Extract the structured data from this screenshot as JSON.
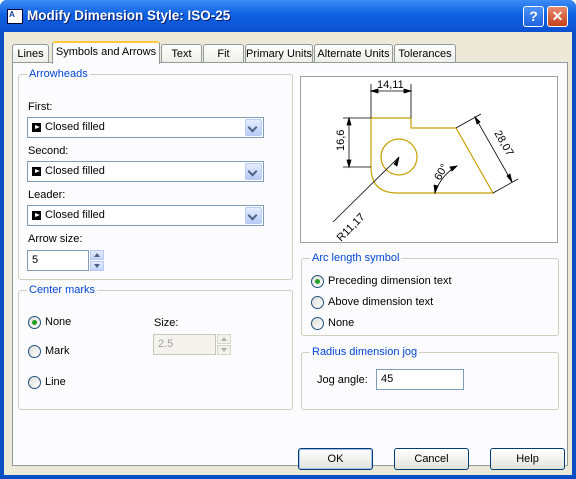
{
  "dialog": {
    "title": "Modify Dimension Style: ISO-25",
    "help_glyph": "?",
    "close_glyph": "✕",
    "app_icon_glyph": "A"
  },
  "tabs": [
    {
      "label": "Lines"
    },
    {
      "label": "Symbols and Arrows",
      "active": true
    },
    {
      "label": "Text"
    },
    {
      "label": "Fit"
    },
    {
      "label": "Primary Units"
    },
    {
      "label": "Alternate Units"
    },
    {
      "label": "Tolerances"
    }
  ],
  "arrowheads": {
    "title": "Arrowheads",
    "first_label": "First:",
    "first_value": "Closed filled",
    "second_label": "Second:",
    "second_value": "Closed filled",
    "leader_label": "Leader:",
    "leader_value": "Closed filled",
    "arrow_size_label": "Arrow size:",
    "arrow_size_value": "5"
  },
  "center_marks": {
    "title": "Center marks",
    "options": [
      "None",
      "Mark",
      "Line"
    ],
    "selected": "None",
    "size_label": "Size:",
    "size_value": "2.5"
  },
  "preview": {
    "dim_top": "14,11",
    "dim_left": "16,6",
    "dim_right": "28,07",
    "dim_angle": "60°",
    "dim_radius": "R11,17"
  },
  "arc_length_symbol": {
    "title": "Arc length symbol",
    "options": [
      "Preceding dimension text",
      "Above dimension text",
      "None"
    ],
    "selected": "Preceding dimension text"
  },
  "radius_jog": {
    "title": "Radius dimension jog",
    "jog_angle_label": "Jog angle:",
    "jog_angle_value": "45"
  },
  "buttons": {
    "ok": "OK",
    "cancel": "Cancel",
    "help": "Help"
  },
  "colors": {
    "title_bar": "#0a50d0",
    "group_label": "#0046d5",
    "preview_outline": "#c8a000"
  }
}
